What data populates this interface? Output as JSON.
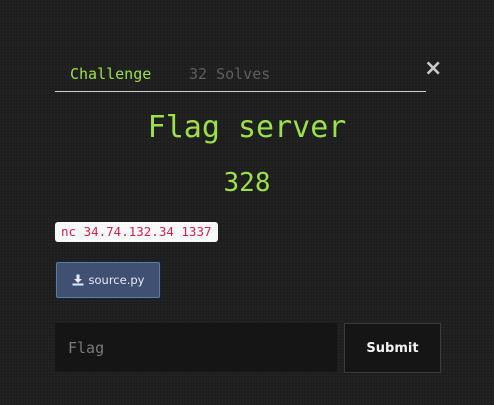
{
  "tabs": {
    "challenge_label": "Challenge",
    "solves_label": "32 Solves"
  },
  "close_glyph": "×",
  "challenge": {
    "name": "Flag server",
    "points": "328",
    "connection": "nc 34.74.132.34 1337",
    "file_label": "source.py",
    "file_icon": "download-icon"
  },
  "form": {
    "flag_placeholder": "Flag",
    "flag_value": "",
    "submit_label": "Submit"
  },
  "colors": {
    "accent": "#9ce04a",
    "tab_inactive": "#5e5e5e",
    "connection_text": "#c7254e",
    "file_button_bg": "#3f5072",
    "background": "#1d1d1d"
  }
}
